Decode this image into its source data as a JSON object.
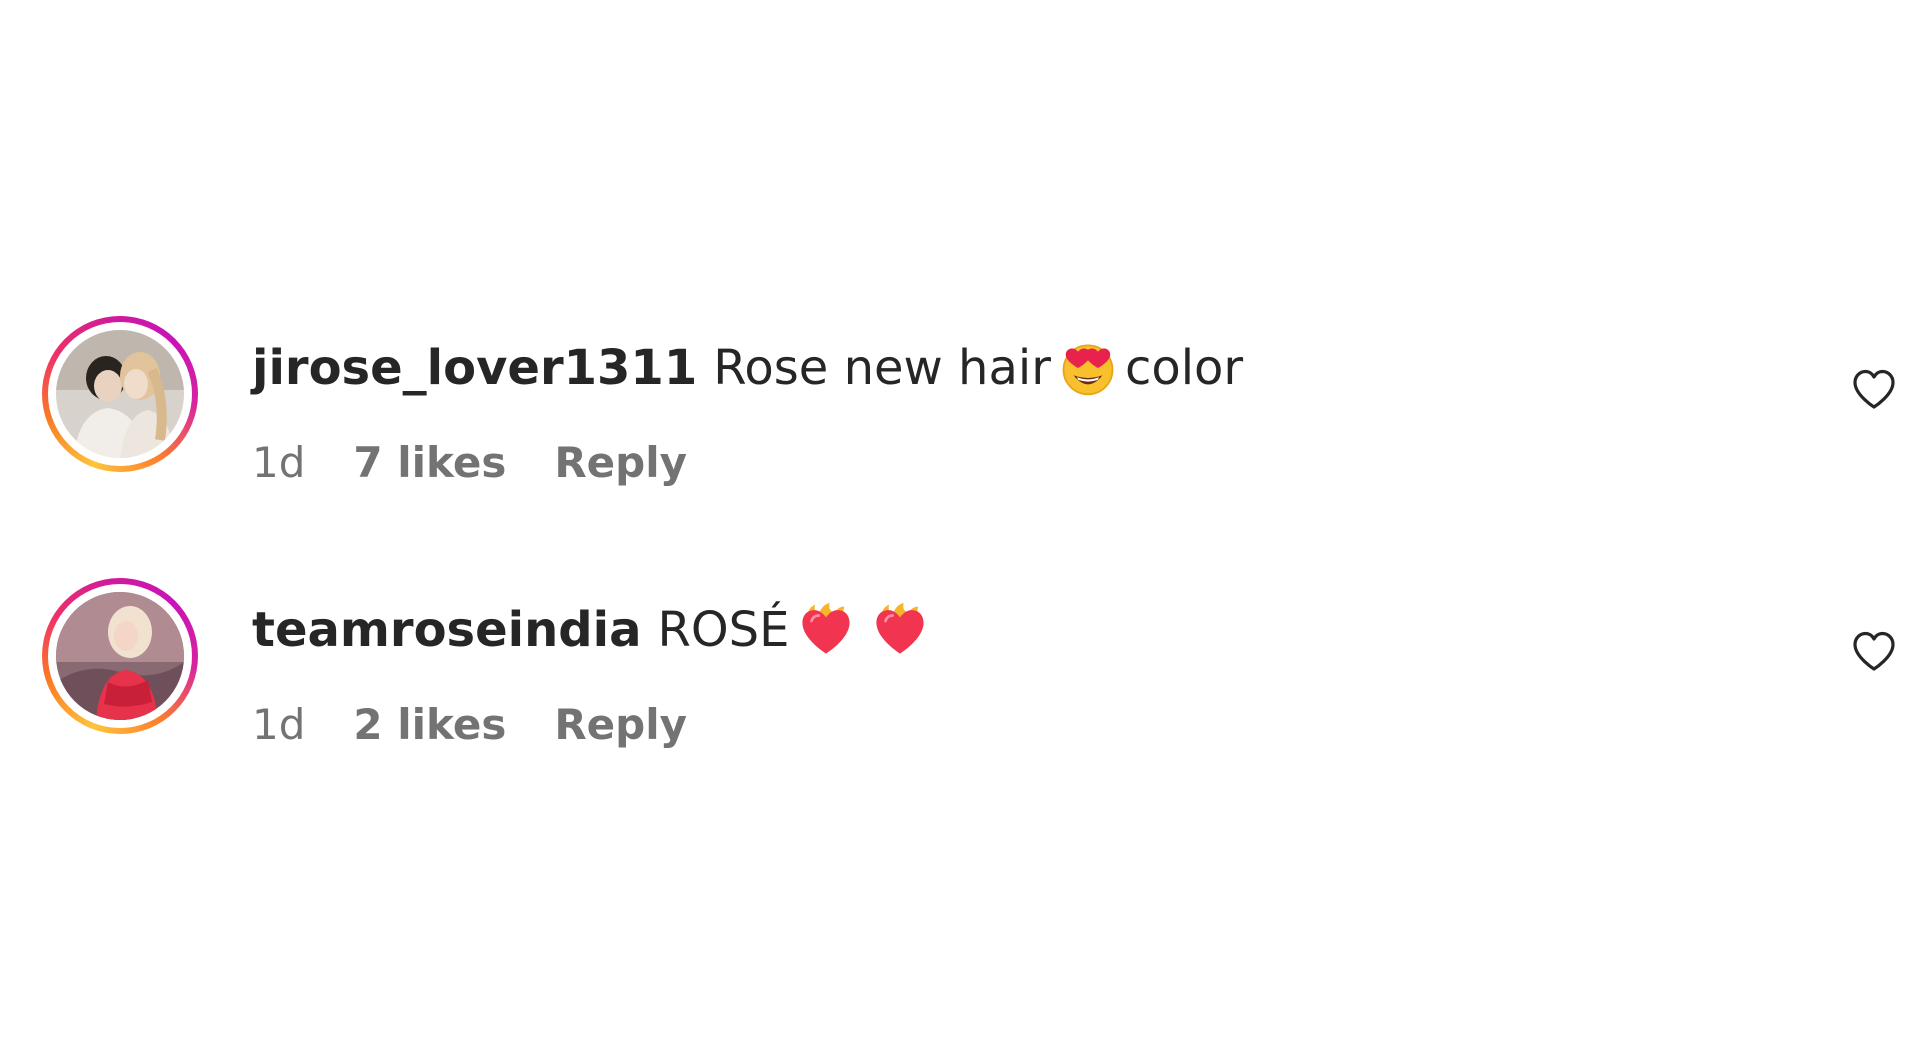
{
  "comments": [
    {
      "username": "jirose_lover1311",
      "text_before_emoji": "Rose new hair",
      "emoji": "smiling-face-with-heart-eyes-icon",
      "text_after_emoji": "color",
      "age": "1d",
      "likes": "7 likes",
      "reply": "Reply",
      "avatar": "couple-photo-avatar"
    },
    {
      "username": "teamroseindia",
      "text_before_emoji": "ROSÉ",
      "emoji": "heart-on-fire-icon",
      "emoji_count": 2,
      "age": "1d",
      "likes": "2 likes",
      "reply": "Reply",
      "avatar": "woman-in-red-dress-avatar"
    }
  ],
  "colors": {
    "text_primary": "#262626",
    "text_secondary": "#737373",
    "story_ring_start": "#fdc43c",
    "story_ring_end": "#c913b9"
  }
}
